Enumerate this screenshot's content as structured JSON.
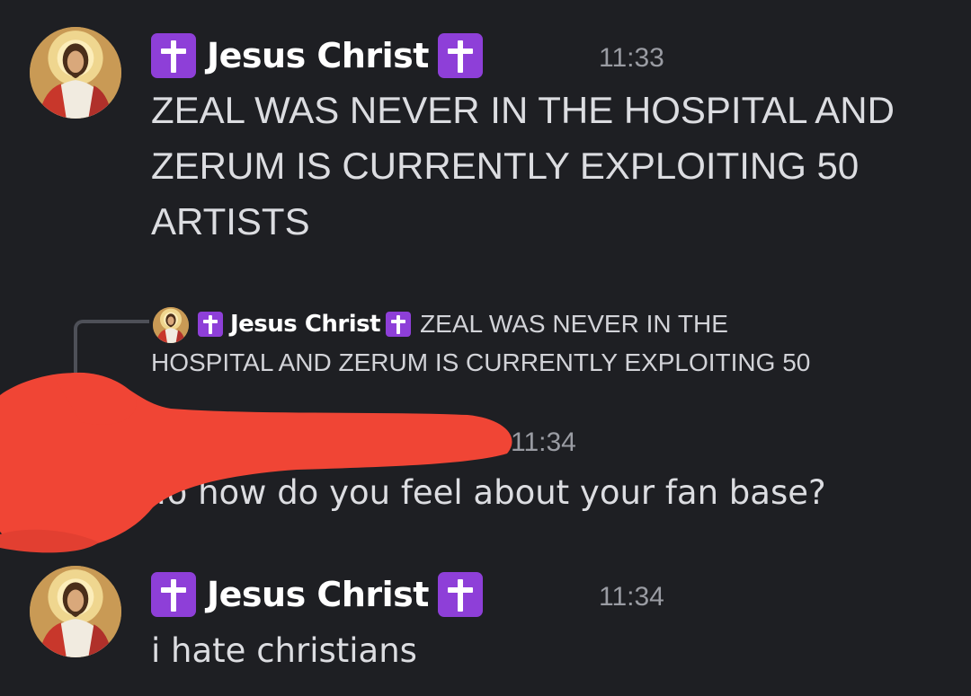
{
  "messages": [
    {
      "author": "Jesus Christ",
      "time": "11:33",
      "text": "ZEAL WAS NEVER IN THE HOSPITAL AND ZERUM IS CURRENTLY EXPLOITING 50 ARTISTS",
      "lines": [
        "ZEAL WAS NEVER IN THE HOSPITAL AND",
        "ZERUM IS CURRENTLY EXPLOITING 50",
        "ARTISTS"
      ]
    },
    {
      "reply_to": {
        "author": "Jesus Christ",
        "text_line1": "ZEAL WAS NEVER IN THE",
        "text_line2": "HOSPITAL AND ZERUM IS CURRENTLY EXPLOITING 50"
      },
      "author": "",
      "author_redacted": true,
      "time": "11:34",
      "text": "Yo how do you feel about your fan base?"
    },
    {
      "author": "Jesus Christ",
      "time": "11:34",
      "text": "i hate christians"
    }
  ],
  "icons": {
    "author_badge": "latin-cross-icon",
    "avatar": "jesus-portrait-avatar"
  },
  "colors": {
    "background": "#1e1f23",
    "badge": "#8e3fd8",
    "username": "#ffffff",
    "timestamp": "#9a9ca3",
    "message_text": "#dcdde1",
    "redaction": "#f04535"
  }
}
